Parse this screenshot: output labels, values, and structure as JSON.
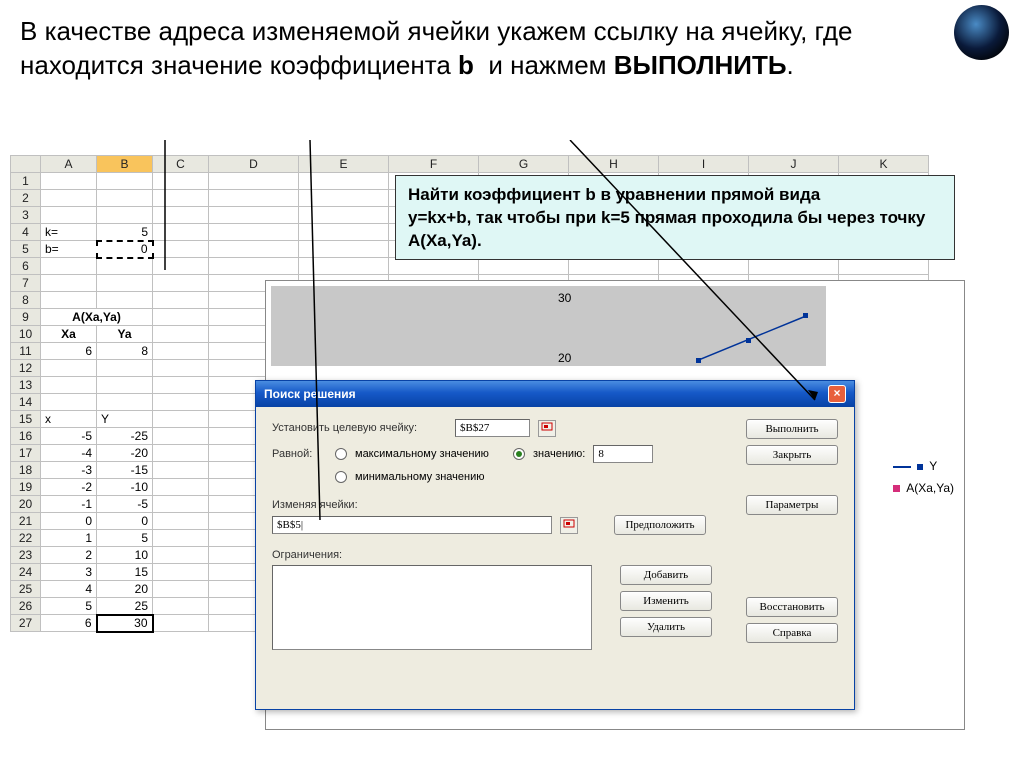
{
  "header": {
    "text_p1": "В качестве адреса изменяемой ячейки укажем ссылку на ячейку, где находится значение коэффициента",
    "bold_b": "b",
    "text_p2": "и нажмем",
    "bold_exec": "ВЫПОЛНИТЬ"
  },
  "columns": [
    "A",
    "B",
    "C",
    "D",
    "E",
    "F",
    "G",
    "H",
    "I",
    "J",
    "K"
  ],
  "rows_left": [
    {
      "n": "1",
      "A": "",
      "B": ""
    },
    {
      "n": "2",
      "A": "",
      "B": ""
    },
    {
      "n": "3",
      "A": "",
      "B": ""
    },
    {
      "n": "4",
      "A": "k=",
      "B": "5"
    },
    {
      "n": "5",
      "A": "b=",
      "B": "0"
    },
    {
      "n": "6",
      "A": "",
      "B": ""
    },
    {
      "n": "7",
      "A": "",
      "B": ""
    },
    {
      "n": "8",
      "A": "",
      "B": ""
    },
    {
      "n": "9",
      "A": "A(Xa,Ya)",
      "B": ""
    },
    {
      "n": "10",
      "A": "Xa",
      "B": "Ya"
    },
    {
      "n": "11",
      "A": "6",
      "B": "8"
    },
    {
      "n": "12",
      "A": "",
      "B": ""
    },
    {
      "n": "13",
      "A": "",
      "B": ""
    },
    {
      "n": "14",
      "A": "",
      "B": ""
    },
    {
      "n": "15",
      "A": "x",
      "B": "Y"
    },
    {
      "n": "16",
      "A": "-5",
      "B": "-25"
    },
    {
      "n": "17",
      "A": "-4",
      "B": "-20"
    },
    {
      "n": "18",
      "A": "-3",
      "B": "-15"
    },
    {
      "n": "19",
      "A": "-2",
      "B": "-10"
    },
    {
      "n": "20",
      "A": "-1",
      "B": "-5"
    },
    {
      "n": "21",
      "A": "0",
      "B": "0"
    },
    {
      "n": "22",
      "A": "1",
      "B": "5"
    },
    {
      "n": "23",
      "A": "2",
      "B": "10"
    },
    {
      "n": "24",
      "A": "3",
      "B": "15"
    },
    {
      "n": "25",
      "A": "4",
      "B": "20"
    },
    {
      "n": "26",
      "A": "5",
      "B": "25"
    },
    {
      "n": "27",
      "A": "6",
      "B": "30"
    }
  ],
  "task": {
    "l1": "Найти коэффициент b в уравнении прямой вида",
    "l2_a": "y=kx+b",
    "l2_b": ", так чтобы при",
    "l2_c": "k=5",
    "l2_d": "прямая проходила бы через точку",
    "l2_e": "A(Xa,Ya)"
  },
  "chart": {
    "label30": "30",
    "label20": "20",
    "legend_y": "Y",
    "legend_a": "A(Xa,Ya)"
  },
  "dialog": {
    "title": "Поиск решения",
    "target_label": "Установить целевую ячейку:",
    "target_value": "$B$27",
    "equal_label": "Равной:",
    "opt_max": "максимальному значению",
    "opt_min": "минимальному значению",
    "opt_val": "значению:",
    "opt_val_value": "8",
    "change_label": "Изменяя ячейки:",
    "change_value": "$B$5|",
    "guess": "Предположить",
    "constraints_label": "Ограничения:",
    "btn_execute": "Выполнить",
    "btn_close": "Закрыть",
    "btn_params": "Параметры",
    "btn_add": "Добавить",
    "btn_edit": "Изменить",
    "btn_delete": "Удалить",
    "btn_restore": "Восстановить",
    "btn_help": "Справка"
  }
}
